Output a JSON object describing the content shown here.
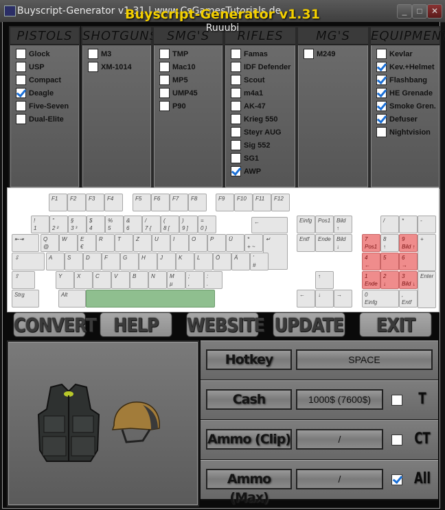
{
  "window": {
    "title": "Buyscript-Generator v1.31 | www.CsGamesTutorials.de",
    "overlay_title": "Buyscript-Generator v1.31",
    "overlay_subtitle": "Ruuubi",
    "controls": {
      "minimize": "_",
      "maximize": "□",
      "close": "✕"
    }
  },
  "categories": [
    {
      "title": "PISTOLS",
      "items": [
        {
          "label": "Glock",
          "checked": false
        },
        {
          "label": "USP",
          "checked": false
        },
        {
          "label": "Compact",
          "checked": false
        },
        {
          "label": "Deagle",
          "checked": true
        },
        {
          "label": "Five-Seven",
          "checked": false
        },
        {
          "label": "Dual-Elite",
          "checked": false
        }
      ]
    },
    {
      "title": "SHOTGUNS",
      "items": [
        {
          "label": "M3",
          "checked": false
        },
        {
          "label": "XM-1014",
          "checked": false
        }
      ]
    },
    {
      "title": "SMG'S",
      "items": [
        {
          "label": "TMP",
          "checked": false
        },
        {
          "label": "Mac10",
          "checked": false
        },
        {
          "label": "MP5",
          "checked": false
        },
        {
          "label": "UMP45",
          "checked": false
        },
        {
          "label": "P90",
          "checked": false
        }
      ]
    },
    {
      "title": "RIFLES",
      "items": [
        {
          "label": "Famas",
          "checked": false
        },
        {
          "label": "IDF Defender",
          "checked": false
        },
        {
          "label": "Scout",
          "checked": false
        },
        {
          "label": "m4a1",
          "checked": false
        },
        {
          "label": "AK-47",
          "checked": false
        },
        {
          "label": "Krieg 550",
          "checked": false
        },
        {
          "label": "Steyr AUG",
          "checked": false
        },
        {
          "label": "Sig 552",
          "checked": false
        },
        {
          "label": "SG1",
          "checked": false
        },
        {
          "label": "AWP",
          "checked": true
        }
      ]
    },
    {
      "title": "MG'S",
      "items": [
        {
          "label": "M249",
          "checked": false
        }
      ]
    },
    {
      "title": "EQUIPMENT",
      "items": [
        {
          "label": "Kevlar",
          "checked": false
        },
        {
          "label": "Kev.+Helmet",
          "checked": true
        },
        {
          "label": "Flashbang",
          "checked": true
        },
        {
          "label": "HE Grenade",
          "checked": true
        },
        {
          "label": "Smoke Gren.",
          "checked": true
        },
        {
          "label": "Defuser",
          "checked": true
        },
        {
          "label": "Nightvision",
          "checked": false
        }
      ]
    }
  ],
  "keyboard": {
    "fkeys": [
      "F1",
      "F2",
      "F3",
      "F4",
      "F5",
      "F6",
      "F7",
      "F8",
      "F9",
      "F10",
      "F11",
      "F12"
    ],
    "number_row": [
      {
        "up": "!",
        "lo": "1"
      },
      {
        "up": "\"",
        "lo": "2 ²"
      },
      {
        "up": "§",
        "lo": "3 ³"
      },
      {
        "up": "$",
        "lo": "4"
      },
      {
        "up": "%",
        "lo": "5"
      },
      {
        "up": "&",
        "lo": "6"
      },
      {
        "up": "/",
        "lo": "7 {"
      },
      {
        "up": "(",
        "lo": "8 ["
      },
      {
        "up": ")",
        "lo": "9 ]"
      },
      {
        "up": "=",
        "lo": "0 }"
      }
    ],
    "backspace": "←",
    "tab": "⇤⇥",
    "row_q": [
      {
        "up": "Q",
        "lo": "@"
      },
      {
        "up": "W",
        "lo": ""
      },
      {
        "up": "E",
        "lo": "€"
      },
      {
        "up": "R",
        "lo": ""
      },
      {
        "up": "T",
        "lo": ""
      },
      {
        "up": "Z",
        "lo": ""
      },
      {
        "up": "U",
        "lo": ""
      },
      {
        "up": "I",
        "lo": ""
      },
      {
        "up": "O",
        "lo": ""
      },
      {
        "up": "P",
        "lo": ""
      },
      {
        "up": "Ü",
        "lo": ""
      },
      {
        "up": "*",
        "lo": "+ ~"
      }
    ],
    "enter": "↵",
    "caps": "⇩",
    "row_a": [
      {
        "up": "A",
        "lo": ""
      },
      {
        "up": "S",
        "lo": ""
      },
      {
        "up": "D",
        "lo": ""
      },
      {
        "up": "F",
        "lo": ""
      },
      {
        "up": "G",
        "lo": ""
      },
      {
        "up": "H",
        "lo": ""
      },
      {
        "up": "J",
        "lo": ""
      },
      {
        "up": "K",
        "lo": ""
      },
      {
        "up": "L",
        "lo": ""
      },
      {
        "up": "Ö",
        "lo": ""
      },
      {
        "up": "Ä",
        "lo": ""
      },
      {
        "up": "'",
        "lo": "#"
      }
    ],
    "shift": "⇧",
    "row_y": [
      {
        "up": "Y",
        "lo": ""
      },
      {
        "up": "X",
        "lo": ""
      },
      {
        "up": "C",
        "lo": ""
      },
      {
        "up": "V",
        "lo": ""
      },
      {
        "up": "B",
        "lo": ""
      },
      {
        "up": "N",
        "lo": ""
      },
      {
        "up": "M",
        "lo": "µ"
      },
      {
        "up": ";",
        "lo": ","
      },
      {
        "up": ":",
        "lo": "."
      }
    ],
    "ctrl": "Strg",
    "alt": "Alt",
    "nav_keys": [
      {
        "up": "Einfg",
        "lo": ""
      },
      {
        "up": "Pos1",
        "lo": ""
      },
      {
        "up": "Bild",
        "lo": "↑"
      },
      {
        "up": "Entf",
        "lo": ""
      },
      {
        "up": "Ende",
        "lo": ""
      },
      {
        "up": "Bild",
        "lo": "↓"
      }
    ],
    "arrows": {
      "up": "↑",
      "left": "←",
      "down": "↓",
      "right": "→"
    },
    "numpad_top": [
      "/",
      "*",
      "-"
    ],
    "numpad": [
      {
        "up": "7",
        "lo": "Pos1",
        "hl": true
      },
      {
        "up": "8",
        "lo": "↑",
        "hl": false
      },
      {
        "up": "9",
        "lo": "Bild ↑",
        "hl": true
      },
      {
        "up": "4",
        "lo": "←",
        "hl": true
      },
      {
        "up": "5",
        "lo": "",
        "hl": true
      },
      {
        "up": "6",
        "lo": "→",
        "hl": true
      },
      {
        "up": "1",
        "lo": "Ende",
        "hl": true
      },
      {
        "up": "2",
        "lo": "↓",
        "hl": true
      },
      {
        "up": "3",
        "lo": "Bild ↓",
        "hl": true
      }
    ],
    "numpad_plus": "+",
    "numpad_enter": "Enter",
    "numpad_zero": {
      "up": "0",
      "lo": "Einfg"
    },
    "numpad_dot": {
      "up": ",",
      "lo": "Entf"
    },
    "space_highlight_color": "#8fbf8f",
    "numpad_highlight_color": "#ef8c8c"
  },
  "nav_buttons": [
    "CONVERT",
    "HELP",
    "WEBSITE",
    "UPDATE",
    "EXIT"
  ],
  "settings": [
    {
      "label": "Hotkey",
      "value": "SPACE"
    },
    {
      "label": "Cash",
      "value": "1000$ (7600$)",
      "team": "T",
      "team_checked": false
    },
    {
      "label": "Ammo (Clip)",
      "value": "/",
      "team": "CT",
      "team_checked": false
    },
    {
      "label": "Ammo (Max)",
      "value": "/",
      "team": "All",
      "team_checked": true
    }
  ],
  "images": {
    "vest": "kevlar-vest",
    "helmet": "helmet"
  }
}
